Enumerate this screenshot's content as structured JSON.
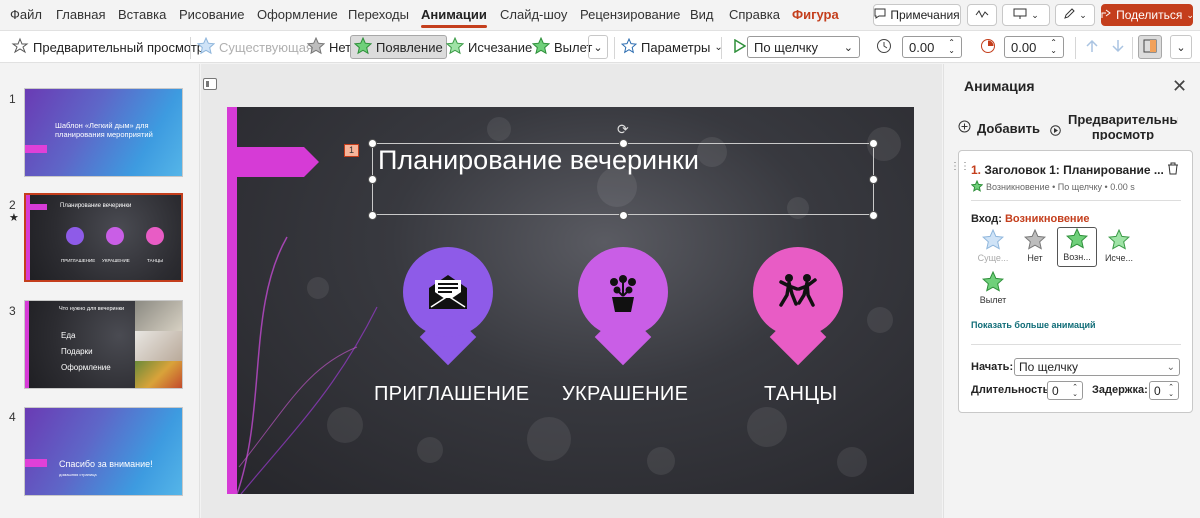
{
  "menu": {
    "items": [
      "Файл",
      "Главная",
      "Вставка",
      "Рисование",
      "Оформление",
      "Переходы",
      "Анимации",
      "Слайд-шоу",
      "Рецензирование",
      "Вид",
      "Справка",
      "Фигура"
    ],
    "comments": "Примечания",
    "share": "Поделиться"
  },
  "ribbon": {
    "preview": "Предварительный просмотр",
    "existing": "Существующая",
    "none": "Нет",
    "appear": "Появление",
    "fade": "Исчезание",
    "fly": "Вылет",
    "params": "Параметры",
    "start": "По щелчку",
    "duration": "0.00",
    "delay": "0.00"
  },
  "thumbs": {
    "nums": [
      "1",
      "2",
      "3",
      "4"
    ],
    "s1": "Шаблон «Легкий дым» для планирования мероприятий",
    "s2_title": "Планирование вечеринки",
    "s2_caps": [
      "ПРИГЛАШЕНИЕ",
      "УКРАШЕНИЕ",
      "ТАНЦЫ"
    ],
    "s3_title": "Что нужно для вечеринки",
    "s3_items": [
      "Еда",
      "Подарки",
      "Оформление"
    ],
    "s4": "Спасибо за внимание!",
    "s4_sub": "домашняя страница"
  },
  "slide": {
    "anim_tag": "1",
    "title": "Планирование вечеринки",
    "caps": [
      "ПРИГЛАШЕНИЕ",
      "УКРАШЕНИЕ",
      "ТАНЦЫ"
    ]
  },
  "pane": {
    "title": "Анимация",
    "add": "Добавить",
    "preview": "Предварительный просмотр",
    "item_num": "1.",
    "item_title": "Заголовок 1: Планирование ...",
    "item_sub": "Возникновение • По щелчку • 0.00 s",
    "entry_label": "Вход:",
    "entry_value": "Возникновение",
    "effects": [
      "Суще...",
      "Нет",
      "Возн...",
      "Исче...",
      "Вылет"
    ],
    "more": "Показать больше анимаций",
    "start_label": "Начать:",
    "start_value": "По щелчку",
    "dur_label": "Длительность:",
    "dur_value": "0",
    "delay_label": "Задержка:",
    "delay_value": "0"
  },
  "colors": {
    "accent": "#c43e1c",
    "purple": "#8e5be8",
    "violet": "#c95ee6",
    "pink": "#e85cc5",
    "magenta": "#d63bd6"
  }
}
